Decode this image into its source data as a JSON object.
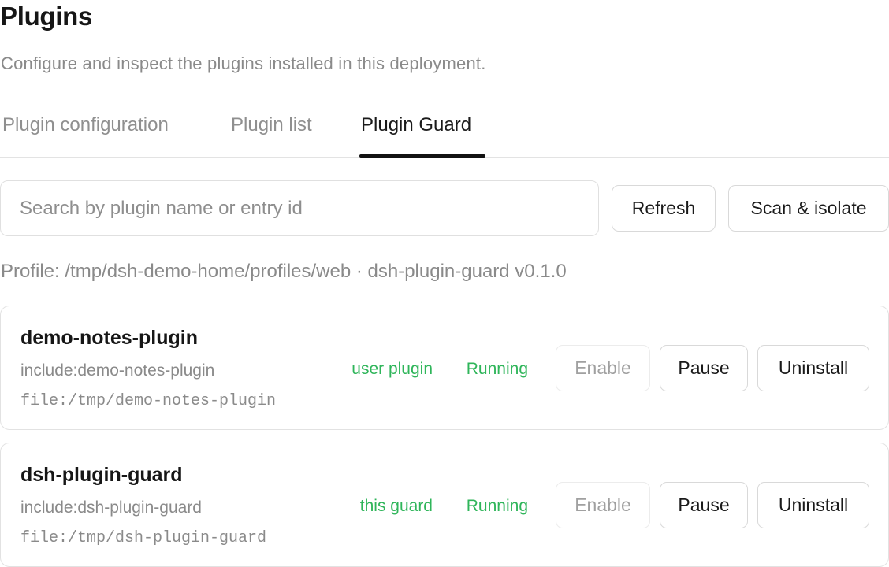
{
  "header": {
    "title": "Plugins",
    "subtitle": "Configure and inspect the plugins installed in this deployment."
  },
  "tabs": [
    {
      "label": "Plugin configuration",
      "active": false
    },
    {
      "label": "Plugin list",
      "active": false
    },
    {
      "label": "Plugin Guard",
      "active": true
    }
  ],
  "toolbar": {
    "search_placeholder": "Search by plugin name or entry id",
    "search_value": "",
    "refresh_label": "Refresh",
    "scan_label": "Scan & isolate"
  },
  "profile_line": "Profile: /tmp/dsh-demo-home/profiles/web · dsh-plugin-guard v0.1.0",
  "status_color": "#2fb55a",
  "plugins": [
    {
      "name": "demo-notes-plugin",
      "entry": "include:demo-notes-plugin",
      "path": "file:/tmp/demo-notes-plugin",
      "tag": "user plugin",
      "status": "Running",
      "enable_label": "Enable",
      "pause_label": "Pause",
      "uninstall_label": "Uninstall"
    },
    {
      "name": "dsh-plugin-guard",
      "entry": "include:dsh-plugin-guard",
      "path": "file:/tmp/dsh-plugin-guard",
      "tag": "this guard",
      "status": "Running",
      "enable_label": "Enable",
      "pause_label": "Pause",
      "uninstall_label": "Uninstall"
    }
  ]
}
